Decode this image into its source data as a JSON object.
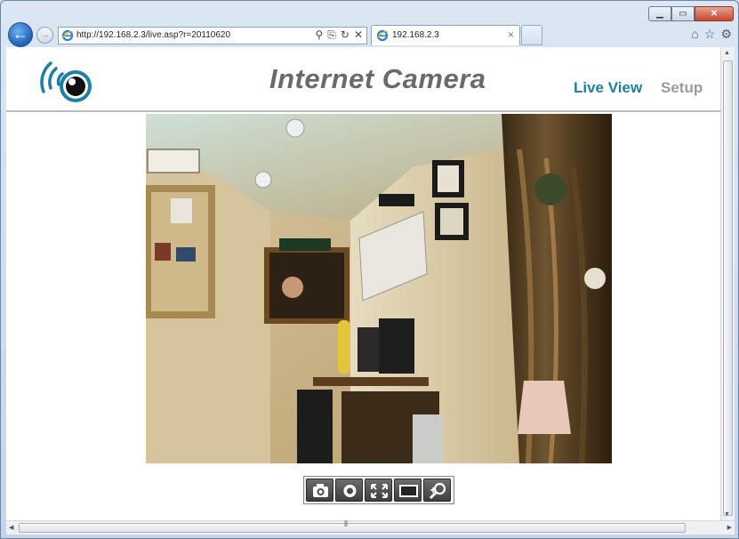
{
  "browser": {
    "url": "http://192.168.2.3/live.asp?r=20110620",
    "tab_title": "192.168.2.3"
  },
  "page": {
    "title": "Internet Camera",
    "nav": {
      "live_view": "Live View",
      "setup": "Setup"
    }
  },
  "colors": {
    "accent": "#1f7ea8",
    "title_gray": "#6a6a6a",
    "inactive_nav": "#9a9a9a"
  },
  "controls": [
    {
      "icon": "camera-icon",
      "label": "snapshot"
    },
    {
      "icon": "record-icon",
      "label": "record"
    },
    {
      "icon": "fit-icon",
      "label": "resize"
    },
    {
      "icon": "fullscreen-icon",
      "label": "full screen"
    },
    {
      "icon": "zoom-icon",
      "label": "zoom"
    }
  ]
}
